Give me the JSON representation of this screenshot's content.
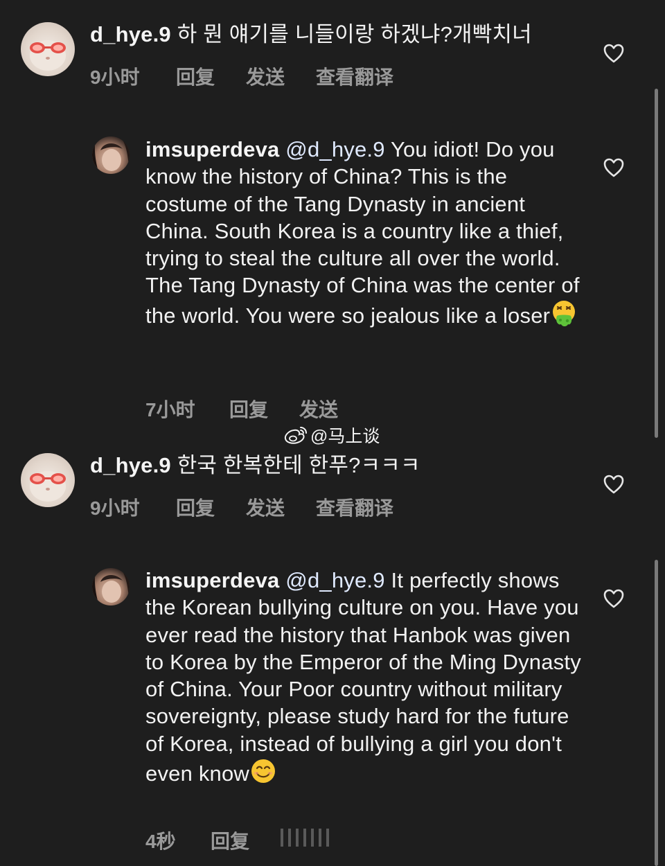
{
  "comments": [
    {
      "username": "d_hye.9",
      "mention": "",
      "text": "하 뭔 얘기를 니들이랑 하겠냐?개빡치너",
      "time": "9小时",
      "reply": "回复",
      "send": "发送",
      "translate": "查看翻译"
    },
    {
      "username": "imsuperdeva",
      "mention": "@d_hye.9",
      "text": "You idiot! Do you know the history of China? This is the costume of the Tang Dynasty in ancient China. South Korea is a country like a thief, trying to steal the culture all over the world. The Tang Dynasty of China was the center of the world. You were so jealous like a loser",
      "time": "7小时",
      "reply": "回复",
      "send": "发送"
    },
    {
      "username": "d_hye.9",
      "mention": "",
      "text": "한국 한복한테 한푸?ㅋㅋㅋ",
      "time": "9小时",
      "reply": "回复",
      "send": "发送",
      "translate": "查看翻译"
    },
    {
      "username": "imsuperdeva",
      "mention": "@d_hye.9",
      "text": "It perfectly shows the Korean bullying culture on you. Have you ever read the history that Hanbok was given to Korea by the Emperor of the Ming Dynasty of China. Your Poor country without military sovereignty, please study hard for the future of Korea, instead of bullying a girl you don't even know",
      "time": "4秒",
      "reply": "回复"
    }
  ],
  "watermark": {
    "text": "@马上谈",
    "icon": "weibo-icon"
  },
  "icons": {
    "like": "heart-outline-icon",
    "vomit": "vomiting-face-emoji",
    "smile": "smiling-face-emoji"
  }
}
